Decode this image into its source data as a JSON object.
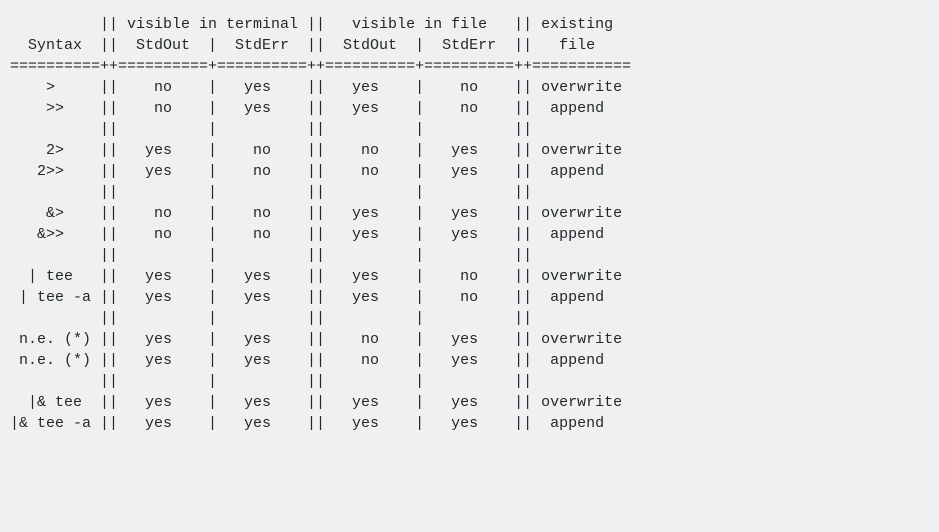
{
  "title_line1": {
    "syntax": "",
    "term_stdout": "visible in",
    "term_stderr": "terminal",
    "file_stdout": "visible",
    "file_stderr": "in file",
    "existing": "existing"
  },
  "title_line2": {
    "syntax": "Syntax",
    "term_stdout": "StdOut",
    "term_stderr": "StdErr",
    "file_stdout": "StdOut",
    "file_stderr": "StdErr",
    "existing": "file"
  },
  "groups": [
    [
      {
        "syntax": ">",
        "term_stdout": "no",
        "term_stderr": "yes",
        "file_stdout": "yes",
        "file_stderr": "no",
        "existing": "overwrite"
      },
      {
        "syntax": ">>",
        "term_stdout": "no",
        "term_stderr": "yes",
        "file_stdout": "yes",
        "file_stderr": "no",
        "existing": "append"
      }
    ],
    [
      {
        "syntax": "2>",
        "term_stdout": "yes",
        "term_stderr": "no",
        "file_stdout": "no",
        "file_stderr": "yes",
        "existing": "overwrite"
      },
      {
        "syntax": "2>>",
        "term_stdout": "yes",
        "term_stderr": "no",
        "file_stdout": "no",
        "file_stderr": "yes",
        "existing": "append"
      }
    ],
    [
      {
        "syntax": "&>",
        "term_stdout": "no",
        "term_stderr": "no",
        "file_stdout": "yes",
        "file_stderr": "yes",
        "existing": "overwrite"
      },
      {
        "syntax": "&>>",
        "term_stdout": "no",
        "term_stderr": "no",
        "file_stdout": "yes",
        "file_stderr": "yes",
        "existing": "append"
      }
    ],
    [
      {
        "syntax": "| tee",
        "term_stdout": "yes",
        "term_stderr": "yes",
        "file_stdout": "yes",
        "file_stderr": "no",
        "existing": "overwrite"
      },
      {
        "syntax": "| tee -a",
        "term_stdout": "yes",
        "term_stderr": "yes",
        "file_stdout": "yes",
        "file_stderr": "no",
        "existing": "append"
      }
    ],
    [
      {
        "syntax": "n.e. (*)",
        "term_stdout": "yes",
        "term_stderr": "yes",
        "file_stdout": "no",
        "file_stderr": "yes",
        "existing": "overwrite"
      },
      {
        "syntax": "n.e. (*)",
        "term_stdout": "yes",
        "term_stderr": "yes",
        "file_stdout": "no",
        "file_stderr": "yes",
        "existing": "append"
      }
    ],
    [
      {
        "syntax": "|& tee",
        "term_stdout": "yes",
        "term_stderr": "yes",
        "file_stdout": "yes",
        "file_stderr": "yes",
        "existing": "overwrite"
      },
      {
        "syntax": "|& tee -a",
        "term_stdout": "yes",
        "term_stderr": "yes",
        "file_stdout": "yes",
        "file_stderr": "yes",
        "existing": "append"
      }
    ]
  ],
  "widths": {
    "syntax": 10,
    "term_stdout": 10,
    "term_stderr": 10,
    "file_stdout": 10,
    "file_stderr": 10,
    "existing": 11
  },
  "align": {
    "header1": {
      "syntax": "center",
      "term_stdout": "left-merge",
      "file_stdout": "left-merge",
      "existing": "left"
    },
    "header2": {
      "syntax": "center",
      "term_stdout": "center",
      "term_stderr": "center",
      "file_stdout": "center",
      "file_stderr": "center",
      "existing": "center"
    },
    "row": {
      "syntax": "center",
      "term_stdout": "center",
      "term_stderr": "center",
      "file_stdout": "center",
      "file_stderr": "center",
      "existing": "left"
    }
  }
}
